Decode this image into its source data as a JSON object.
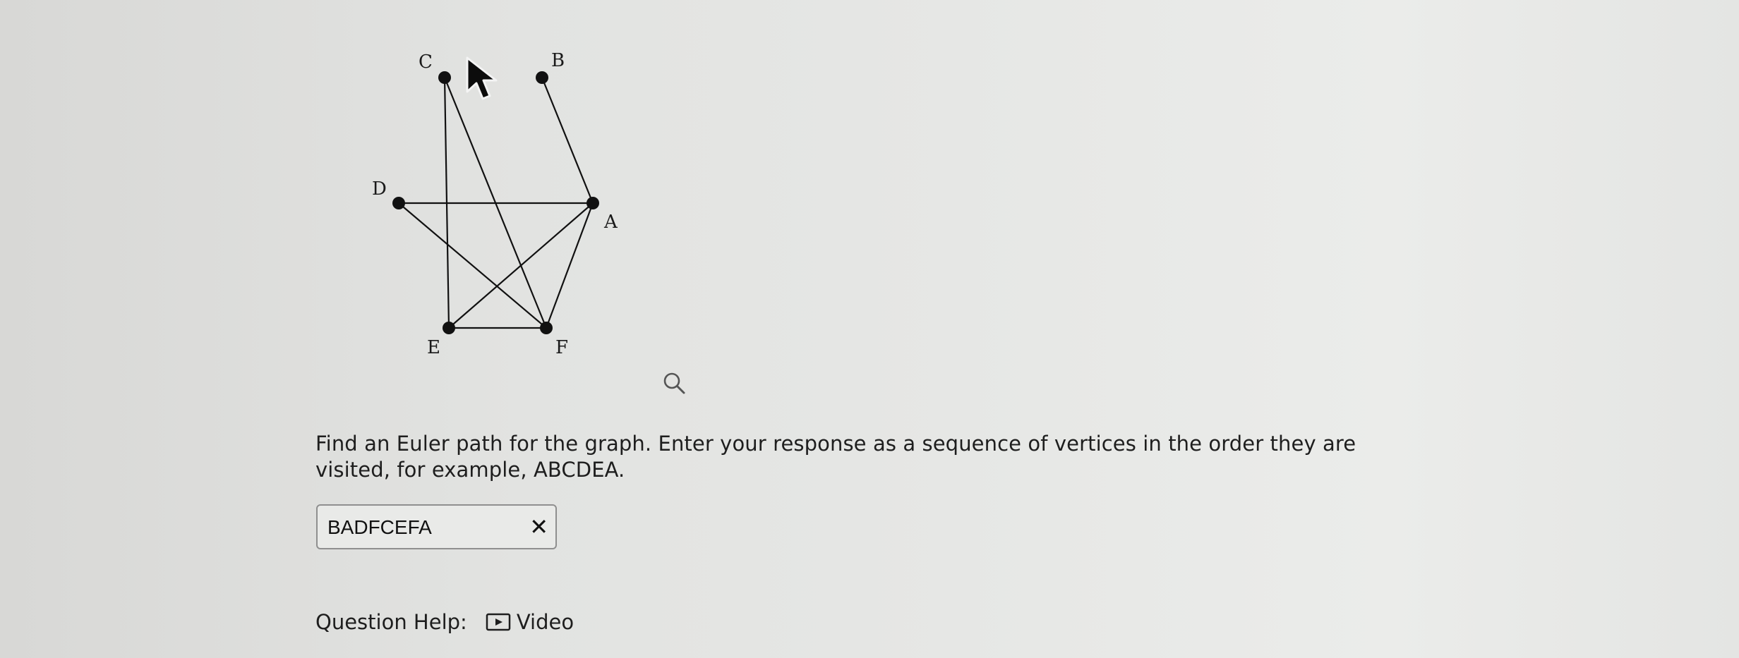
{
  "graph": {
    "vertices": [
      "A",
      "B",
      "C",
      "D",
      "E",
      "F"
    ],
    "edges": [
      [
        "B",
        "A"
      ],
      [
        "C",
        "E"
      ],
      [
        "C",
        "F"
      ],
      [
        "D",
        "A"
      ],
      [
        "D",
        "F"
      ],
      [
        "A",
        "E"
      ],
      [
        "A",
        "F"
      ],
      [
        "E",
        "F"
      ]
    ]
  },
  "question": {
    "text": "Find an Euler path for the graph. Enter your response as a sequence of vertices in the order they are visited, for example, ABCDEA."
  },
  "answer": {
    "value": "BADFCEFA",
    "status": "incorrect",
    "status_mark": "✕"
  },
  "help": {
    "label": "Question Help:",
    "video_label": "Video"
  },
  "icons": {
    "zoom": "magnifier-icon",
    "video": "play-video-icon",
    "cursor": "mouse-pointer-icon"
  }
}
